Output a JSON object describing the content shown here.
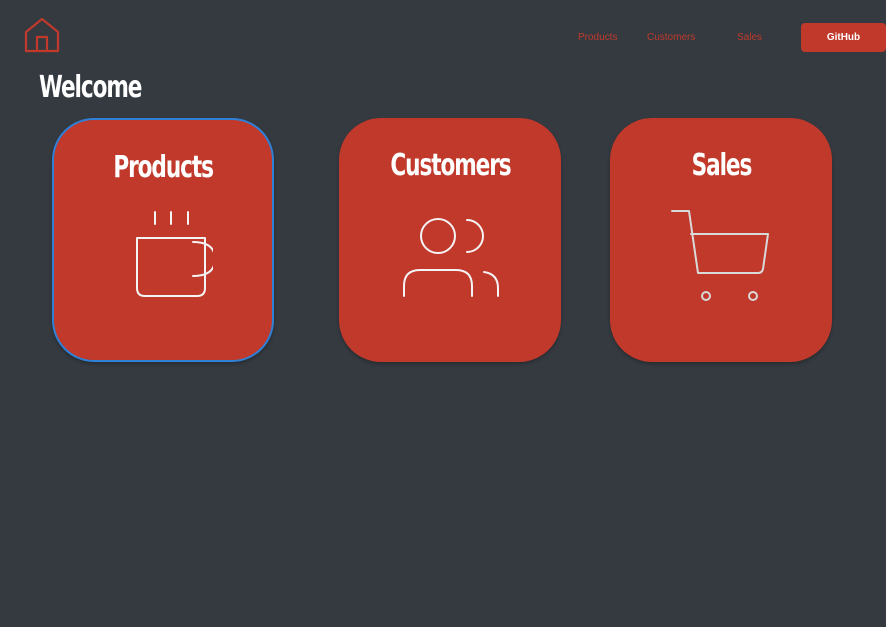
{
  "header": {
    "home_icon": "home-icon",
    "nav": {
      "products": "Products",
      "customers": "Customers",
      "sales": "Sales",
      "github": "GitHub"
    }
  },
  "page_title": "Welcome",
  "cards": [
    {
      "title": "Products",
      "icon": "coffee-cup-icon",
      "selected": true
    },
    {
      "title": "Customers",
      "icon": "users-icon",
      "selected": false
    },
    {
      "title": "Sales",
      "icon": "shopping-cart-icon",
      "selected": false
    }
  ],
  "colors": {
    "background": "#343a40",
    "accent": "#c0392b",
    "focus_outline": "#2f80d6",
    "text": "#ffffff"
  }
}
